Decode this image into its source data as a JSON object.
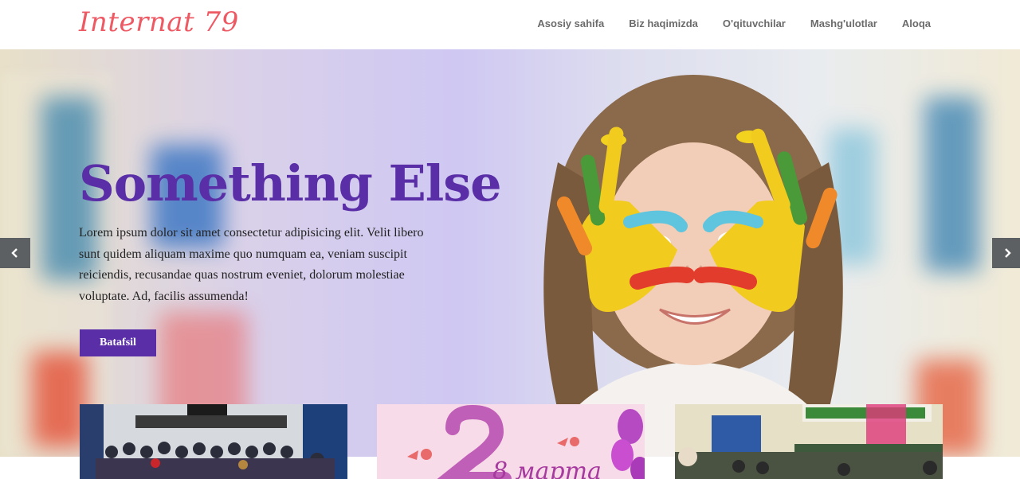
{
  "header": {
    "logo": "Internat 79",
    "nav": [
      "Asosiy sahifa",
      "Biz haqimizda",
      "O'qituvchilar",
      "Mashg'ulotlar",
      "Aloqa"
    ]
  },
  "hero": {
    "title": "Something Else",
    "text": "Lorem ipsum dolor sit amet consectetur adipisicing elit. Velit libero sunt quidem aliquam maxime quo numquam ea, veniam suscipit reiciendis, recusandae quas nostrum eveniet, dolorum molestiae voluptate. Ad, facilis assumenda!",
    "button": "Batafsil",
    "prev_icon": "chevron-left-icon",
    "next_icon": "chevron-right-icon"
  },
  "cards": [
    {
      "name": "school-group-photo"
    },
    {
      "name": "march-8-greeting-card",
      "overlay_text": "8 марта"
    },
    {
      "name": "classroom-photo"
    }
  ],
  "colors": {
    "brand": "#ee5a64",
    "accent": "#5a2ea6",
    "arrow_bg": "#5d6062"
  }
}
